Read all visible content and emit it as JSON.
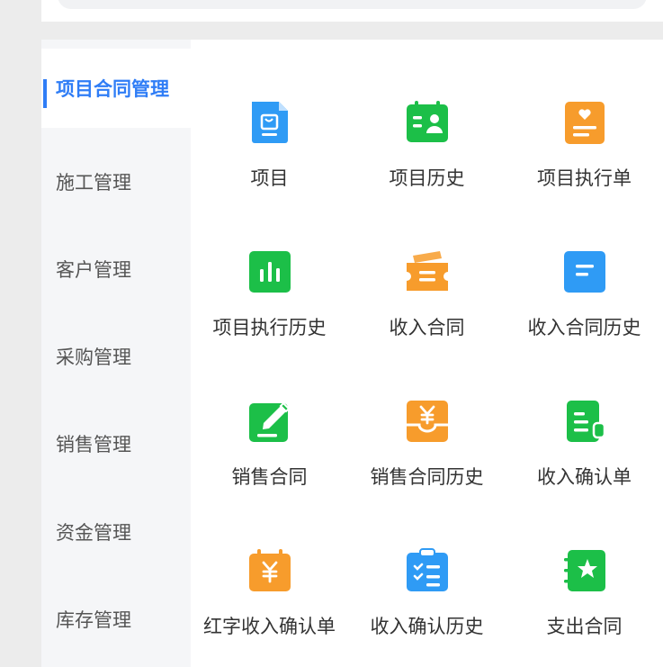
{
  "sidebar": {
    "items": [
      {
        "label": "项目合同管理",
        "active": true
      },
      {
        "label": "施工管理"
      },
      {
        "label": "客户管理"
      },
      {
        "label": "采购管理"
      },
      {
        "label": "销售管理"
      },
      {
        "label": "资金管理"
      },
      {
        "label": "库存管理"
      }
    ]
  },
  "grid": {
    "items": [
      {
        "label": "项目",
        "icon": "document-bag-icon",
        "color": "#2f9bf5"
      },
      {
        "label": "项目历史",
        "icon": "calendar-person-icon",
        "color": "#1cbf48"
      },
      {
        "label": "项目执行单",
        "icon": "heart-list-icon",
        "color": "#f79c2c"
      },
      {
        "label": "项目执行历史",
        "icon": "bar-chart-icon",
        "color": "#1cbf48"
      },
      {
        "label": "收入合同",
        "icon": "ticket-icon",
        "color": "#f79c2c"
      },
      {
        "label": "收入合同历史",
        "icon": "document-lines-icon",
        "color": "#2f9bf5"
      },
      {
        "label": "销售合同",
        "icon": "edit-pen-icon",
        "color": "#1cbf48"
      },
      {
        "label": "销售合同历史",
        "icon": "yen-tray-icon",
        "color": "#f79c2c"
      },
      {
        "label": "收入确认单",
        "icon": "receipt-icon",
        "color": "#1cbf48"
      },
      {
        "label": "红字收入确认单",
        "icon": "yen-calendar-icon",
        "color": "#f79c2c"
      },
      {
        "label": "收入确认历史",
        "icon": "clipboard-checklist-icon",
        "color": "#2f9bf5"
      },
      {
        "label": "支出合同",
        "icon": "star-book-icon",
        "color": "#1cbf48"
      }
    ]
  }
}
